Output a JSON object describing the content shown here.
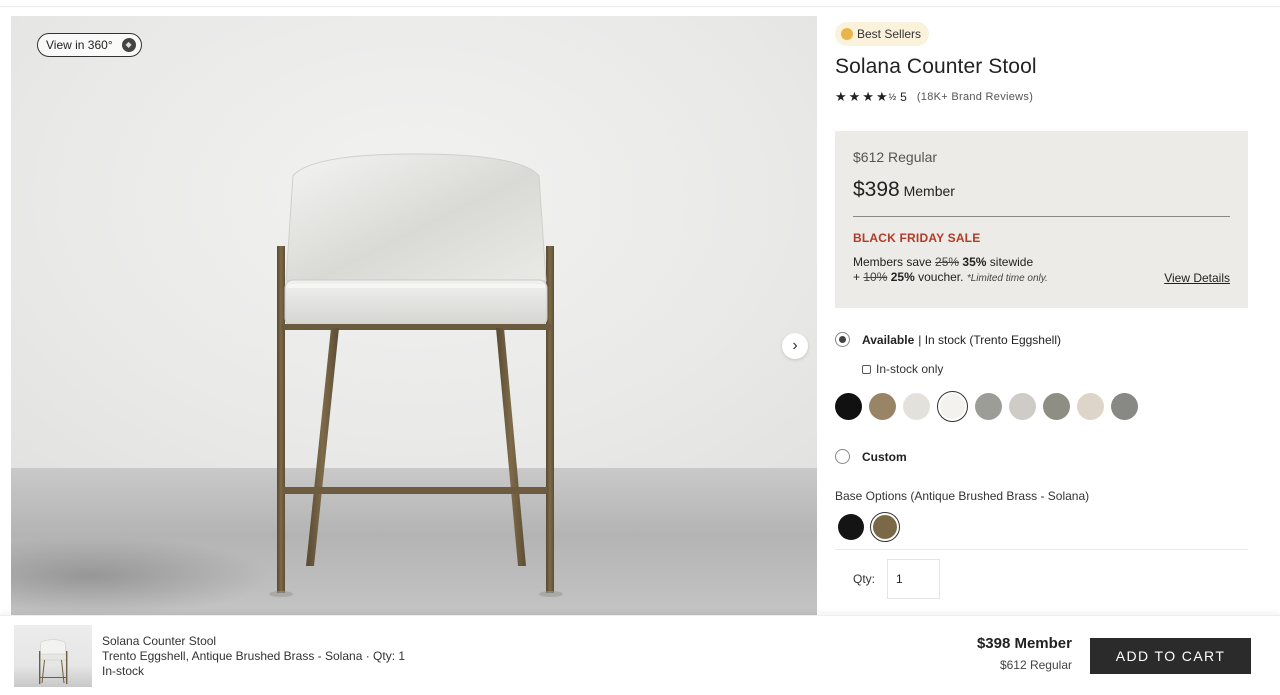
{
  "gallery": {
    "view360_label": "View in 360°",
    "view360_icon": "cube-360-icon",
    "next_icon": "chevron-right-icon",
    "next_glyph": "›"
  },
  "product": {
    "badge": "Best Sellers",
    "badge_icon": "medal-icon",
    "title": "Solana Counter Stool",
    "stars": "★★★★",
    "half_star": "½",
    "rating": "5",
    "reviews": "(18K+ Brand Reviews)"
  },
  "pricing": {
    "regular": "$612 Regular",
    "member_amount": "$398",
    "member_label": "Member",
    "sale_title": "BLACK FRIDAY SALE",
    "save_prefix": "Members save",
    "save_old": "25%",
    "save_new": "35%",
    "save_suffix": "sitewide",
    "voucher_prefix": "+",
    "voucher_old": "10%",
    "voucher_new": "25%",
    "voucher_suffix": "voucher.",
    "limited": "*Limited time only.",
    "view_details": "View Details"
  },
  "options": {
    "available_label": "Available",
    "available_sub": "| In stock (Trento Eggshell)",
    "instock_only": "In-stock only",
    "custom_label": "Custom",
    "fabric_swatches": [
      {
        "color": "#111111"
      },
      {
        "color": "#9a8466"
      },
      {
        "color": "#e3e1dc"
      },
      {
        "color": "#f3f2ee",
        "selected": true
      },
      {
        "color": "#9b9d96"
      },
      {
        "color": "#cfccc7"
      },
      {
        "color": "#8f8e84"
      },
      {
        "color": "#ddd5c7"
      },
      {
        "color": "#888885"
      }
    ],
    "base_label": "Base Options (Antique Brushed Brass - Solana)",
    "base_swatches": [
      {
        "color": "#141414"
      },
      {
        "color": "#7b6846",
        "selected": true
      }
    ],
    "qty_label": "Qty:",
    "qty_value": "1"
  },
  "sticky": {
    "name": "Solana Counter Stool",
    "details": "Trento Eggshell, Antique Brushed Brass - Solana · Qty: 1",
    "stock": "In-stock",
    "member": "$398 Member",
    "regular": "$612 Regular",
    "add_to_cart": "ADD TO CART"
  },
  "colors": {
    "accent_dark": "#2b2b2b",
    "sale_red": "#b23b26",
    "price_box_bg": "#ecebe8",
    "frame_brass": "#6f5e40"
  }
}
